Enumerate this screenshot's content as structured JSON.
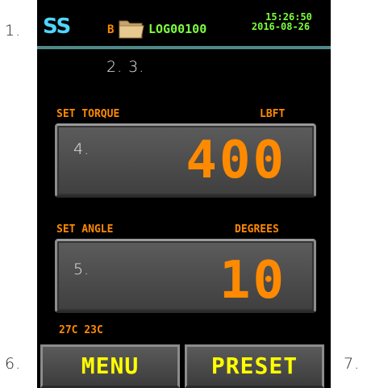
{
  "callouts": {
    "c1": "1.",
    "c2": "2. 3.",
    "c4": "4.",
    "c5": "5.",
    "c6": "6.",
    "c7": "7."
  },
  "status": {
    "logo": "SS",
    "drive": "B",
    "folder_icon": "folder-icon",
    "log_name": "LOG00100",
    "time": "15:26:50",
    "date": "2016-08-26",
    "divider_color": "#4f8a8a"
  },
  "torque": {
    "label": "SET TORQUE",
    "unit": "LBFT",
    "value": "400"
  },
  "angle": {
    "label": "SET ANGLE",
    "unit": "DEGREES",
    "value": "10"
  },
  "temperatures": "27C 23C",
  "softkeys": {
    "menu": "MENU",
    "preset": "PRESET"
  },
  "colors": {
    "value": "#ff8a00",
    "softkey_text": "#ffff00",
    "status_text": "#7dff3c",
    "logo": "#4fd6ff"
  }
}
